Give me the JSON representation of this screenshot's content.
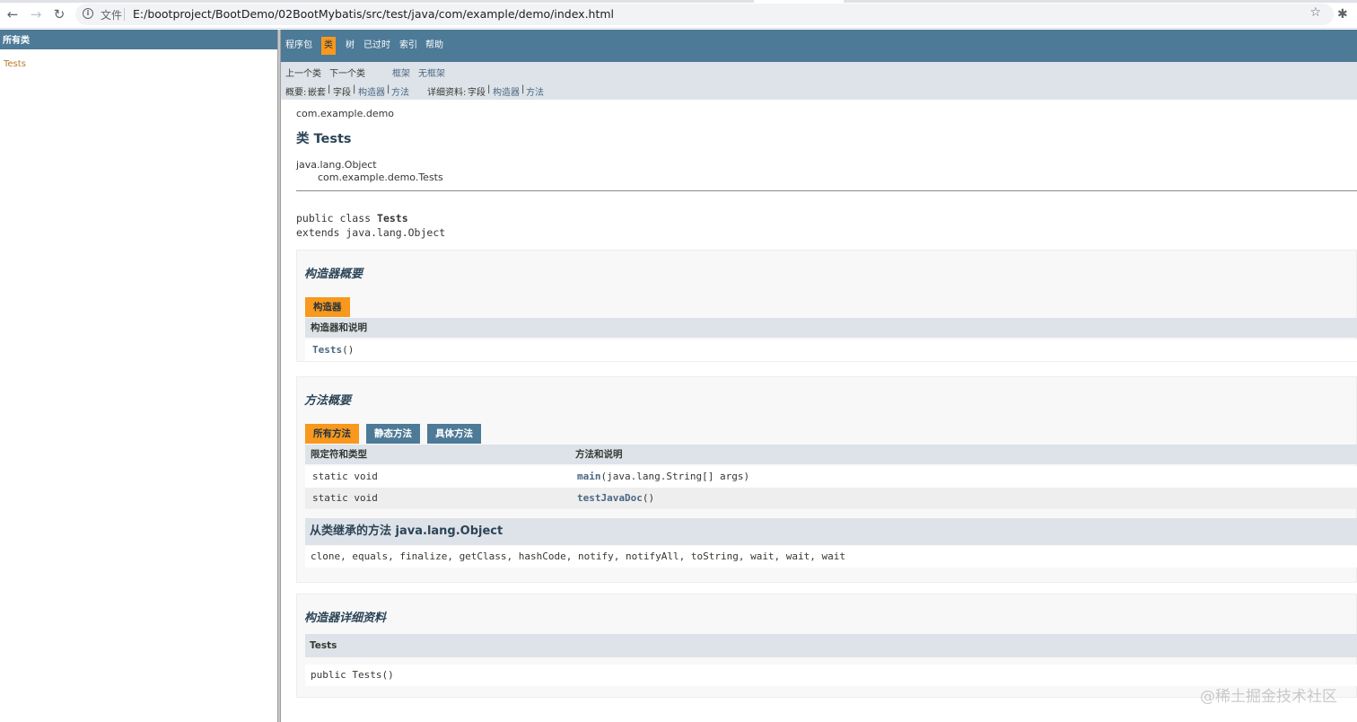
{
  "browser": {
    "protocol_label": "文件",
    "url": "E:/bootproject/BootDemo/02BootMybatis/src/test/java/com/example/demo/index.html"
  },
  "left_frame": {
    "header": "所有类",
    "classes": [
      "Tests"
    ]
  },
  "top_nav": {
    "items": [
      "程序包",
      "类",
      "树",
      "已过时",
      "索引",
      "帮助"
    ],
    "active": "类"
  },
  "sub_nav": {
    "prev_class": "上一个类",
    "next_class": "下一个类",
    "frames": "框架",
    "no_frames": "无框架",
    "summary_label": "概要:",
    "summary_nested": "嵌套",
    "summary_field": "字段",
    "summary_constructor": "构造器",
    "summary_method": "方法",
    "detail_label": "详细资料:",
    "detail_field": "字段",
    "detail_constructor": "构造器",
    "detail_method": "方法",
    "pipe": "|"
  },
  "class_info": {
    "package": "com.example.demo",
    "title": "类 Tests",
    "inheritance_root": "java.lang.Object",
    "inheritance_child": "com.example.demo.Tests",
    "signature_prefix": "public class ",
    "signature_name": "Tests",
    "signature_extends": "extends java.lang.Object"
  },
  "constructor_summary": {
    "heading": "构造器概要",
    "tab": "构造器",
    "column": "构造器和说明",
    "rows": [
      {
        "name": "Tests",
        "args": "()"
      }
    ]
  },
  "method_summary": {
    "heading": "方法概要",
    "tabs": [
      "所有方法",
      "静态方法",
      "具体方法"
    ],
    "columns": [
      "限定符和类型",
      "方法和说明"
    ],
    "rows": [
      {
        "modifier": "static void",
        "name": "main",
        "args": "(java.lang.String[] args)"
      },
      {
        "modifier": "static void",
        "name": "testJavaDoc",
        "args": "()"
      }
    ],
    "inherited_heading": "从类继承的方法 java.lang.Object",
    "inherited_list": "clone, equals, finalize, getClass, hashCode, notify, notifyAll, toString, wait, wait, wait"
  },
  "constructor_detail": {
    "heading": "构造器详细资料",
    "name": "Tests",
    "signature": "public Tests()"
  },
  "watermark": "@稀土掘金技术社区",
  "colors": {
    "nav_blue": "#4d7a97",
    "accent_orange": "#f8981d",
    "subnav_gray": "#dee3e9",
    "link": "#4a6782",
    "left_link": "#bb7a2a"
  }
}
